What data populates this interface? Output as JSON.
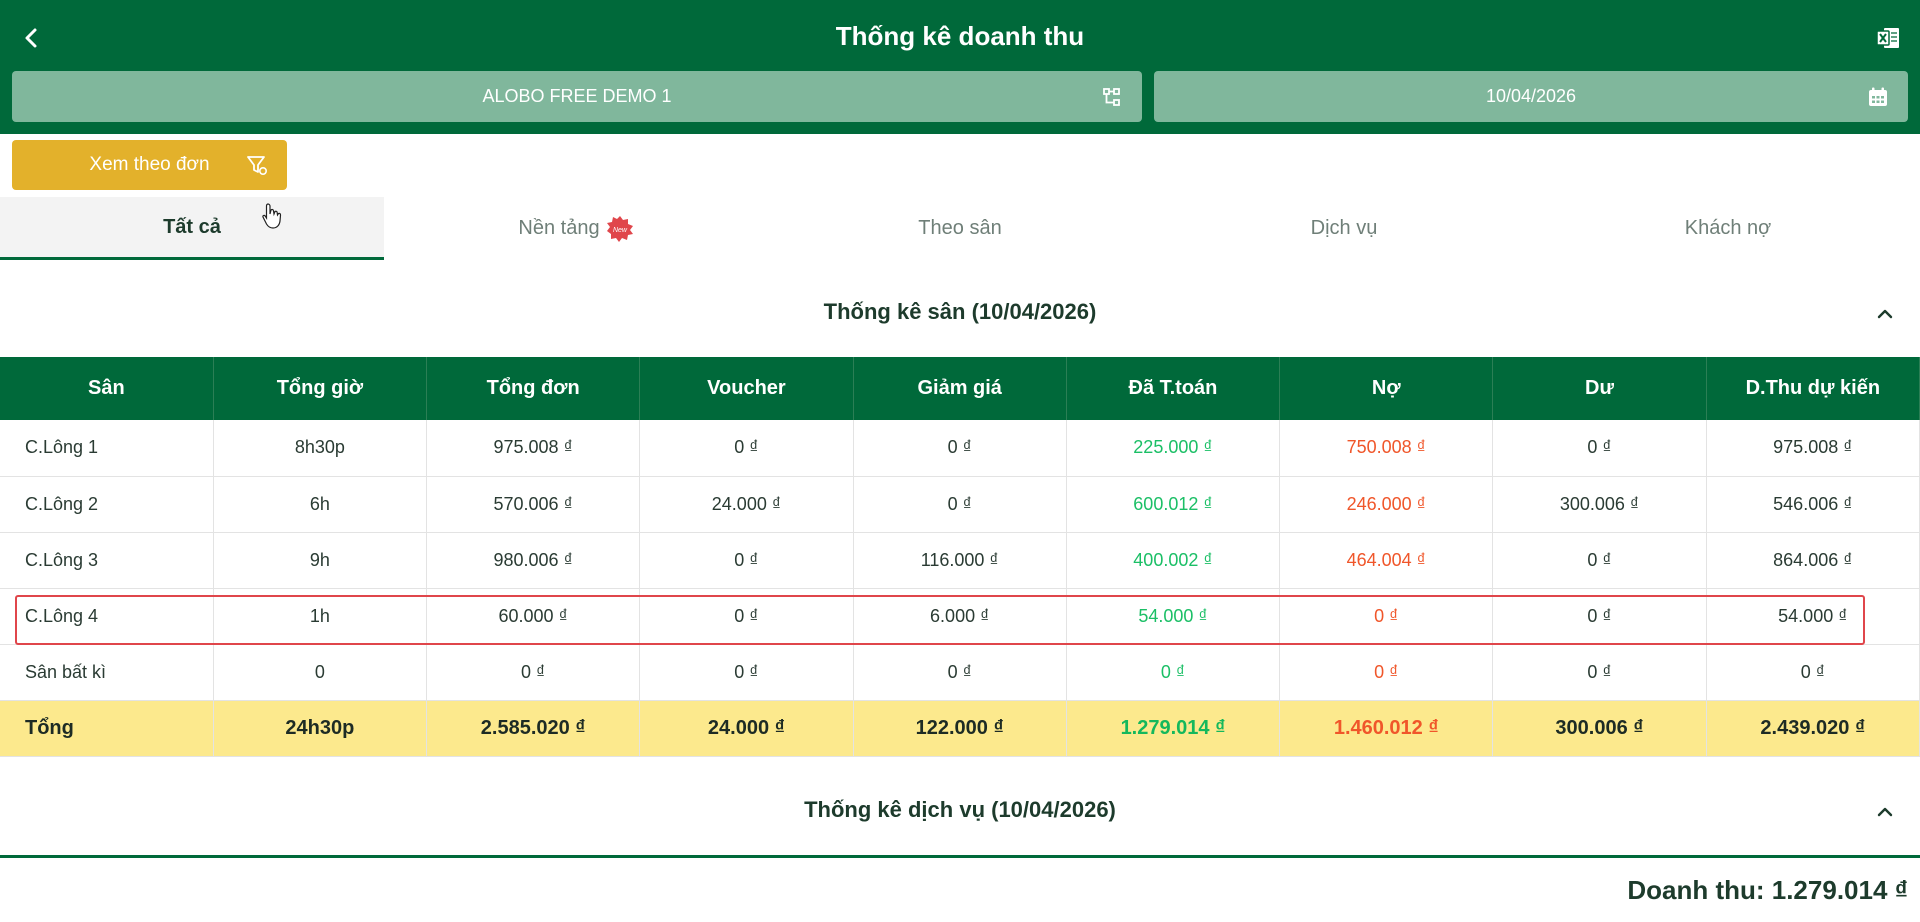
{
  "header": {
    "title": "Thống kê doanh thu",
    "venue": "ALOBO FREE DEMO 1",
    "date": "10/04/2026"
  },
  "view_by_order": "Xem theo đơn",
  "tabs": [
    {
      "label": "Tất cả",
      "active": true
    },
    {
      "label": "Nền tảng",
      "badge": "New"
    },
    {
      "label": "Theo sân"
    },
    {
      "label": "Dịch vụ"
    },
    {
      "label": "Khách nợ"
    }
  ],
  "court_section": {
    "title": "Thống kê sân (10/04/2026)",
    "columns": [
      "Sân",
      "Tổng giờ",
      "Tổng đơn",
      "Voucher",
      "Giảm giá",
      "Đã T.toán",
      "Nợ",
      "Dư",
      "D.Thu dự kiến"
    ],
    "rows": [
      [
        "C.Lông 1",
        "8h30p",
        "975.008 ₫",
        "0 ₫",
        "0 ₫",
        "225.000 ₫",
        "750.008 ₫",
        "0 ₫",
        "975.008 ₫"
      ],
      [
        "C.Lông 2",
        "6h",
        "570.006 ₫",
        "24.000 ₫",
        "0 ₫",
        "600.012 ₫",
        "246.000 ₫",
        "300.006 ₫",
        "546.006 ₫"
      ],
      [
        "C.Lông 3",
        "9h",
        "980.006 ₫",
        "0 ₫",
        "116.000 ₫",
        "400.002 ₫",
        "464.004 ₫",
        "0 ₫",
        "864.006 ₫"
      ],
      [
        "C.Lông 4",
        "1h",
        "60.000 ₫",
        "0 ₫",
        "6.000 ₫",
        "54.000 ₫",
        "0 ₫",
        "0 ₫",
        "54.000 ₫"
      ],
      [
        "Sân bất kì",
        "0",
        "0 ₫",
        "0 ₫",
        "0 ₫",
        "0 ₫",
        "0 ₫",
        "0 ₫",
        "0 ₫"
      ]
    ],
    "total": [
      "Tổng",
      "24h30p",
      "2.585.020 ₫",
      "24.000 ₫",
      "122.000 ₫",
      "1.279.014 ₫",
      "1.460.012 ₫",
      "300.006 ₫",
      "2.439.020 ₫"
    ],
    "highlighted_row": "C.Lông 4"
  },
  "service_section": {
    "title": "Thống kê dịch vụ (10/04/2026)"
  },
  "revenue": "Doanh thu: 1.279.014 ₫",
  "colors": {
    "primary": "#00693a",
    "selector_bg": "#80b79c",
    "accent": "#e3b12b",
    "paid": "#1bbf66",
    "debt": "#f0562a",
    "total_row": "#fce98d",
    "highlight": "#e0464b"
  },
  "icons": [
    "back-arrow-icon",
    "excel-icon",
    "branch-icon",
    "calendar-icon",
    "filter-icon",
    "hand-cursor-icon",
    "new-badge-icon",
    "chevron-up-icon"
  ]
}
